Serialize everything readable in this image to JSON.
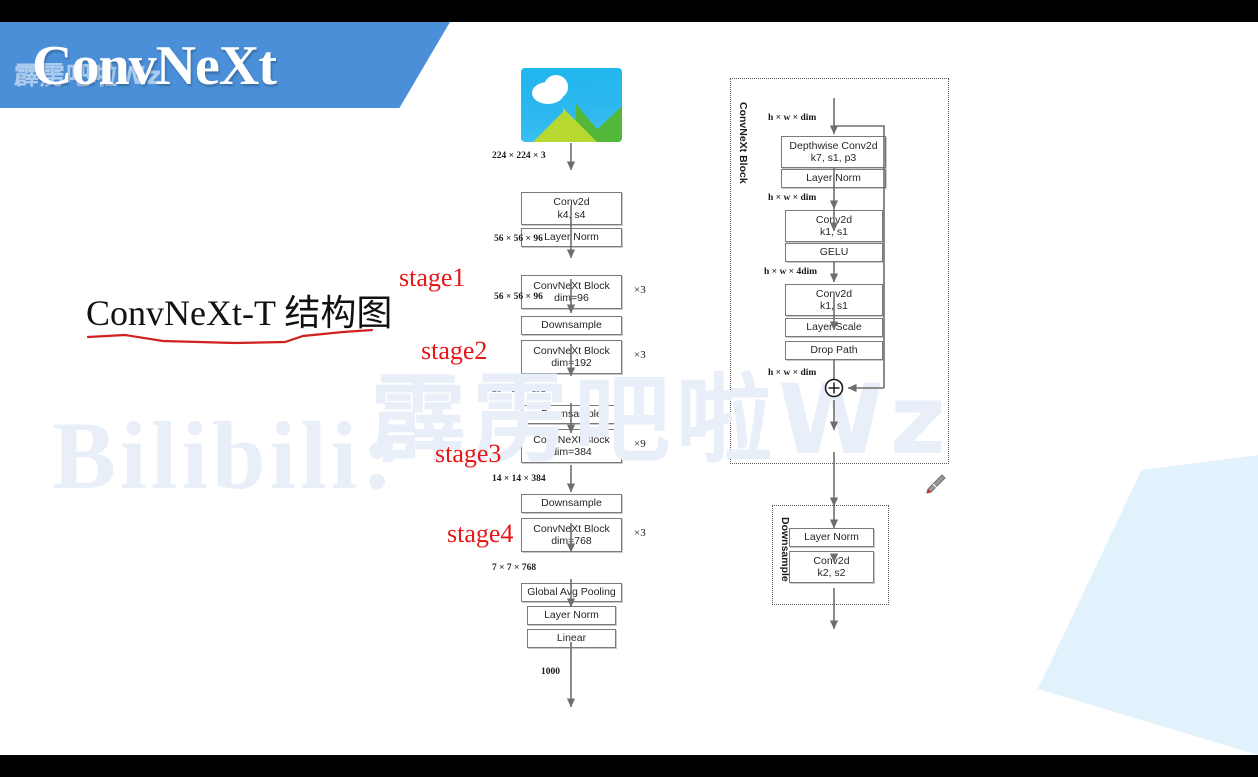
{
  "banner": {
    "title": "ConvNeXt",
    "watermark": "霹雳吧啦Wz"
  },
  "watermarks": {
    "bilibili": "Bilibili:",
    "chinese": "霹雳吧啦Wz"
  },
  "heading": {
    "text": "ConvNeXt-T 结构图"
  },
  "colors": {
    "banner_blue": "#4a8fd8",
    "annotation_red": "#e51717",
    "node_border": "#7b7b7b",
    "corner_triangle": "#ddf0fb",
    "watermark": "#e8eff8"
  },
  "main_pipeline": {
    "input_image_alt": "picture-placeholder",
    "stage_labels": [
      "stage1",
      "stage2",
      "stage3",
      "stage4"
    ],
    "nodes": [
      {
        "id": "conv_stem",
        "line1": "Conv2d",
        "line2": "k4, s4"
      },
      {
        "id": "ln_stem",
        "line1": "Layer Norm",
        "line2": ""
      },
      {
        "id": "block_s1",
        "line1": "ConvNeXt Block",
        "line2": "dim=96"
      },
      {
        "id": "down_1",
        "line1": "Downsample",
        "line2": ""
      },
      {
        "id": "block_s2",
        "line1": "ConvNeXt Block",
        "line2": "dim=192"
      },
      {
        "id": "down_2",
        "line1": "Downsample",
        "line2": ""
      },
      {
        "id": "block_s3",
        "line1": "ConvNeXt Block",
        "line2": "dim=384"
      },
      {
        "id": "down_3",
        "line1": "Downsample",
        "line2": ""
      },
      {
        "id": "block_s4",
        "line1": "ConvNeXt Block",
        "line2": "dim=768"
      },
      {
        "id": "gap",
        "line1": "Global Avg Pooling",
        "line2": ""
      },
      {
        "id": "ln_head",
        "line1": "Layer Norm",
        "line2": ""
      },
      {
        "id": "linear",
        "line1": "Linear",
        "line2": ""
      }
    ],
    "dims": [
      "224 × 224 × 3",
      "56 × 56 × 96",
      "56 × 56 × 96",
      "28 × 28 × 192",
      "14 × 14 × 384",
      "7 × 7 × 768",
      "1000"
    ],
    "repeats": [
      "×3",
      "×3",
      "×9",
      "×3"
    ]
  },
  "convnext_block": {
    "title": "ConvNeXt Block",
    "nodes": [
      {
        "id": "dw_conv",
        "line1": "Depthwise Conv2d",
        "line2": "k7, s1, p3"
      },
      {
        "id": "layer_norm",
        "line1": "Layer Norm",
        "line2": ""
      },
      {
        "id": "conv_1x1_a",
        "line1": "Conv2d",
        "line2": "k1, s1"
      },
      {
        "id": "gelu",
        "line1": "GELU",
        "line2": ""
      },
      {
        "id": "conv_1x1_b",
        "line1": "Conv2d",
        "line2": "k1, s1"
      },
      {
        "id": "layer_scale",
        "line1": "Layer Scale",
        "line2": ""
      },
      {
        "id": "drop_path",
        "line1": "Drop Path",
        "line2": ""
      }
    ],
    "dims": [
      "h × w × dim",
      "h × w × dim",
      "h × w × 4dim",
      "h × w × dim"
    ],
    "add_symbol": "+"
  },
  "downsample_block": {
    "title": "Downsample",
    "nodes": [
      {
        "id": "ds_layer_norm",
        "line1": "Layer Norm",
        "line2": ""
      },
      {
        "id": "ds_conv",
        "line1": "Conv2d",
        "line2": "k2, s2"
      }
    ]
  }
}
